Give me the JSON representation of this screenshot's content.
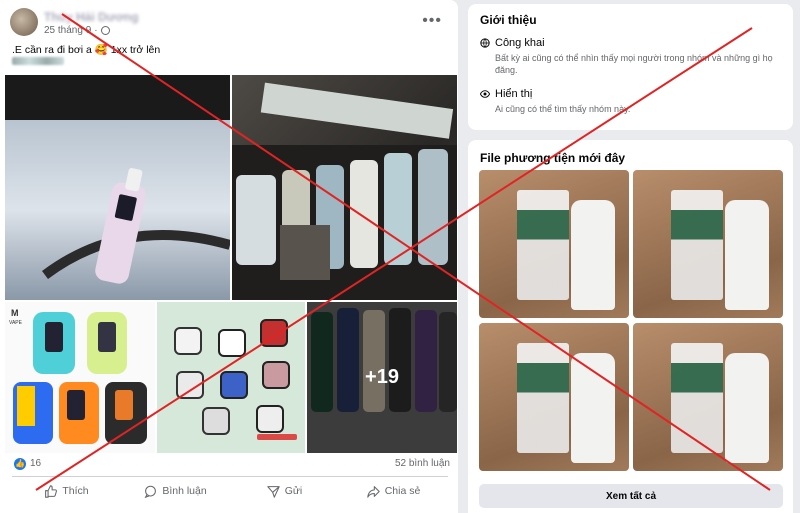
{
  "post": {
    "author": "Thủy Hải Dương",
    "date": "25 tháng 9",
    "caption": ".E cần ra đi bơi a 🥰 1xx trở lên",
    "more_photos": "+19",
    "like_count": "16",
    "comment_count": "52 bình luận",
    "actions": {
      "like": "Thích",
      "comment": "Bình luận",
      "send": "Gửi",
      "share": "Chia sẻ"
    },
    "watermark": "VAPE"
  },
  "intro": {
    "title": "Giới thiệu",
    "public": {
      "title": "Công khai",
      "desc": "Bất kỳ ai cũng có thể nhìn thấy mọi người trong nhóm và những gì họ đăng."
    },
    "visible": {
      "title": "Hiển thị",
      "desc": "Ai cũng có thể tìm thấy nhóm này."
    }
  },
  "media": {
    "title": "File phương tiện mới đây",
    "see_all": "Xem tất cả"
  },
  "colors": {
    "accent": "#1877f2",
    "cross": "#e02424"
  }
}
